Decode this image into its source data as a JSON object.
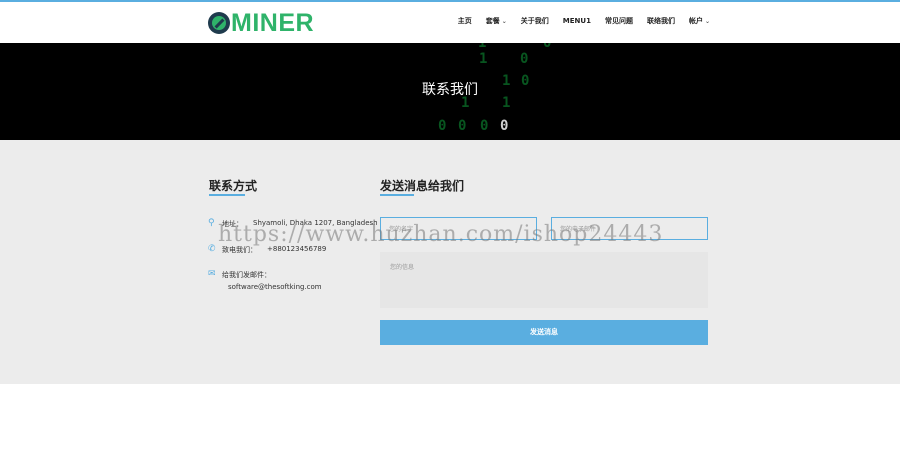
{
  "brand": {
    "name": "MINER",
    "accent": "#5aaee0",
    "logo_green": "#2fb36a"
  },
  "nav": {
    "items": [
      {
        "label": "主页",
        "has_caret": false
      },
      {
        "label": "套餐",
        "has_caret": true
      },
      {
        "label": "关于我们",
        "has_caret": false
      },
      {
        "label": "MENU1",
        "has_caret": false
      },
      {
        "label": "常见问题",
        "has_caret": false
      },
      {
        "label": "联络我们",
        "has_caret": false
      },
      {
        "label": "帐户",
        "has_caret": true
      }
    ]
  },
  "hero": {
    "title": "联系我们"
  },
  "contact": {
    "title": "联系方式",
    "address_label": "地址：",
    "address_value": "Shyamoli, Dhaka 1207, Bangladesh",
    "phone_label": "致电我们：",
    "phone_value": "+880123456789",
    "email_label": "给我们发邮件：",
    "email_value": "software@thesoftking.com"
  },
  "form": {
    "title": "发送消息给我们",
    "name_placeholder": "您的名字",
    "email_placeholder": "您的电子邮件",
    "message_placeholder": "您的信息",
    "submit_label": "发送消息"
  },
  "watermark": {
    "text": "https://www.huzhan.com/ishop24443"
  }
}
